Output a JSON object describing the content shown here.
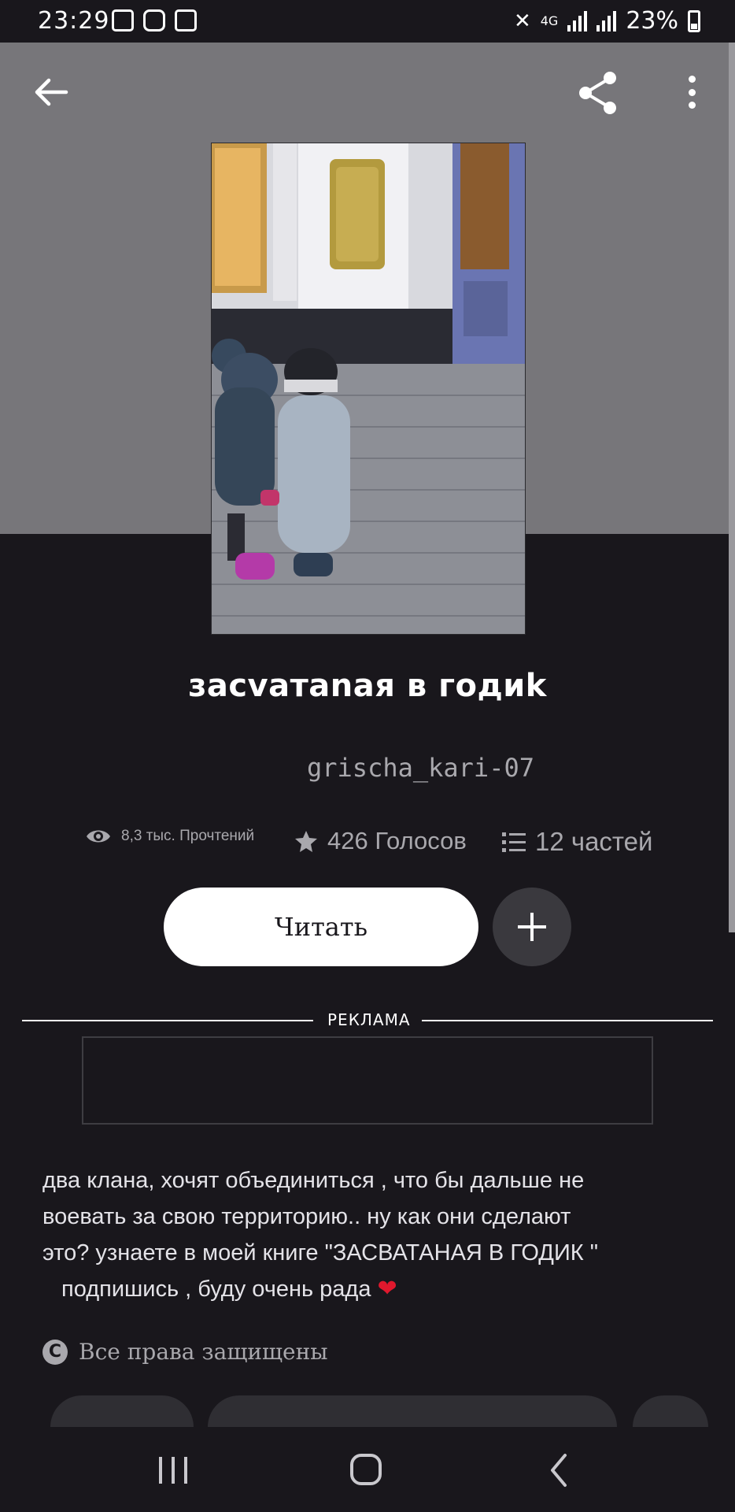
{
  "status_bar": {
    "time": "23:29",
    "network": "4G",
    "battery": "23%"
  },
  "book": {
    "title": "засvатаnая в годиk",
    "author": "grischa_kari-07",
    "stats": {
      "reads": "8,3 тыс. Прочтений",
      "votes": "426 Голосов",
      "parts": "12 частей"
    },
    "read_label": "Читать",
    "description": [
      "два клана, хочят объединиться , что бы дальше не",
      "воевать за свою территорию..  ну как они сделают",
      "это?  узнаете в моей книге \"ЗАСВАТАНАЯ В ГОДИК \"",
      "подпишись , буду очень рада"
    ],
    "copyright": "Все права защищены"
  },
  "ad": {
    "label": "РЕКЛАМА"
  },
  "icons": {
    "back": "arrow-left-icon",
    "share": "share-icon",
    "menu": "more-vertical-icon",
    "reads": "eye-icon",
    "votes": "star-icon",
    "parts": "list-icon",
    "add": "plus-icon",
    "heart": "heart-icon",
    "copyright": "copyright-icon"
  },
  "colors": {
    "background": "#19171c",
    "header": "#77767a",
    "accent_heart": "#e0182d",
    "muted_text": "#a9a8ad"
  }
}
